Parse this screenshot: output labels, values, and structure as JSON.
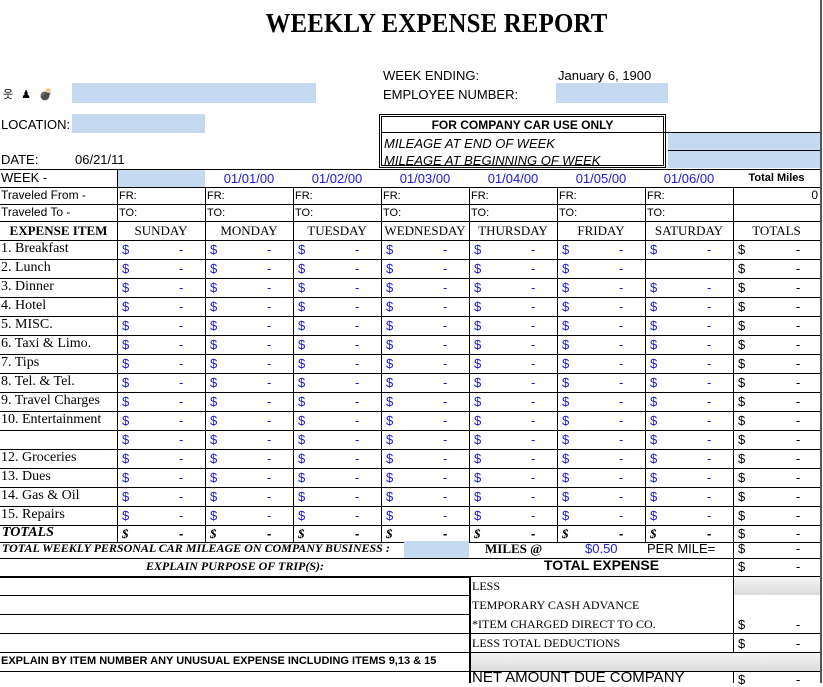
{
  "title": "WEEKLY EXPENSE REPORT",
  "header": {
    "icons": [
      "person-icon",
      "figure-icon",
      "bomb-icon"
    ],
    "icon_glyphs": [
      "웃",
      "♟",
      "💣"
    ],
    "name_value": "",
    "location_label": "LOCATION:",
    "location_value": "",
    "date_label": "DATE:",
    "date_value": "06/21/11",
    "week_ending_label": "WEEK ENDING:",
    "week_ending_value": "January 6, 1900",
    "employee_number_label": "EMPLOYEE NUMBER:",
    "employee_number_value": ""
  },
  "company_car": {
    "title": "FOR COMPANY CAR USE ONLY",
    "mileage_end_label": "MILEAGE AT END OF WEEK",
    "mileage_end_value": "",
    "mileage_begin_label": "MILEAGE AT BEGINNING OF WEEK",
    "mileage_begin_value": ""
  },
  "week_row": {
    "label": "WEEK -",
    "first_value": "",
    "dates": [
      "01/01/00",
      "01/02/00",
      "01/03/00",
      "01/04/00",
      "01/05/00",
      "01/06/00"
    ],
    "total_miles_label": "Total Miles",
    "total_miles_value": "0"
  },
  "travel": {
    "from_label": "Traveled From -",
    "to_label": "Traveled To -",
    "from_prefix": "FR:",
    "to_prefix": "TO:"
  },
  "table": {
    "item_header": "EXPENSE ITEM",
    "days": [
      "SUNDAY",
      "MONDAY",
      "TUESDAY",
      "WEDNESDAY",
      "THURSDAY",
      "FRIDAY",
      "SATURDAY"
    ],
    "totals_header": "TOTALS",
    "currency": "$",
    "empty_value": "-",
    "rows": [
      {
        "label": "1. Breakfast",
        "values": [
          "-",
          "-",
          "-",
          "-",
          "-",
          "-",
          "-"
        ],
        "total": "-"
      },
      {
        "label": "2. Lunch",
        "values": [
          "-",
          "-",
          "-",
          "-",
          "-",
          "-",
          null
        ],
        "total": "-"
      },
      {
        "label": "3. Dinner",
        "values": [
          "-",
          "-",
          "-",
          "-",
          "-",
          "-",
          "-"
        ],
        "total": "-"
      },
      {
        "label": "4. Hotel",
        "values": [
          "-",
          "-",
          "-",
          "-",
          "-",
          "-",
          "-"
        ],
        "total": "-"
      },
      {
        "label": "5.  MISC.",
        "values": [
          "-",
          "-",
          "-",
          "-",
          "-",
          "-",
          "-"
        ],
        "total": "-"
      },
      {
        "label": "6. Taxi & Limo.",
        "values": [
          "-",
          "-",
          "-",
          "-",
          "-",
          "-",
          "-"
        ],
        "total": "-"
      },
      {
        "label": "7. Tips",
        "values": [
          "-",
          "-",
          "-",
          "-",
          "-",
          "-",
          "-"
        ],
        "total": "-"
      },
      {
        "label": "8. Tel. & Tel.",
        "values": [
          "-",
          "-",
          "-",
          "-",
          "-",
          "-",
          "-"
        ],
        "total": "-"
      },
      {
        "label": "9. Travel Charges",
        "values": [
          "-",
          "-",
          "-",
          "-",
          "-",
          "-",
          "-"
        ],
        "total": "-"
      },
      {
        "label": "10. Entertainment",
        "values": [
          "-",
          "-",
          "-",
          "-",
          "-",
          "-",
          "-"
        ],
        "total": "-"
      },
      {
        "label": "",
        "values": [
          "-",
          "-",
          "-",
          "-",
          "-",
          "-",
          "-"
        ],
        "total": "-"
      },
      {
        "label": "12.  Groceries",
        "values": [
          "-",
          "-",
          "-",
          "-",
          "-",
          "-",
          "-"
        ],
        "total": "-"
      },
      {
        "label": "13. Dues",
        "values": [
          "-",
          "-",
          "-",
          "-",
          "-",
          "-",
          "-"
        ],
        "total": "-"
      },
      {
        "label": "14. Gas & Oil",
        "values": [
          "-",
          "-",
          "-",
          "-",
          "-",
          "-",
          "-"
        ],
        "total": "-"
      },
      {
        "label": "15. Repairs",
        "values": [
          "-",
          "-",
          "-",
          "-",
          "-",
          "-",
          "-"
        ],
        "total": "-"
      }
    ],
    "totals_row": {
      "label": "TOTALS",
      "values": [
        "-",
        "-",
        "-",
        "-",
        "-",
        "-",
        "-"
      ],
      "total": "-"
    }
  },
  "mileage": {
    "label": "TOTAL WEEKLY PERSONAL CAR MILEAGE ON COMPANY BUSINESS :",
    "miles_value": "",
    "miles_at_label": "MILES @",
    "rate": "$0.50",
    "per_mile_label": "PER MILE=",
    "amount_currency": "$",
    "amount": "-"
  },
  "summary": {
    "purpose_label": "EXPLAIN PURPOSE OF TRIP(S):",
    "total_expense_label": "TOTAL EXPENSE",
    "total_expense_currency": "$",
    "total_expense_value": "-",
    "less_label": "LESS",
    "cash_advance_label": "TEMPORARY CASH ADVANCE",
    "charged_direct_label": "*ITEM CHARGED DIRECT TO CO.",
    "charged_direct_currency": "$",
    "charged_direct_value": "-",
    "total_deductions_label": "LESS TOTAL DEDUCTIONS",
    "total_deductions_currency": "$",
    "total_deductions_value": "-",
    "unusual_label": "EXPLAIN BY ITEM NUMBER ANY UNUSUAL EXPENSE INCLUDING ITEMS 9,13 & 15",
    "net_due_label": "NET AMOUNT DUE COMPANY",
    "net_due_currency": "$",
    "net_due_value": "-"
  }
}
